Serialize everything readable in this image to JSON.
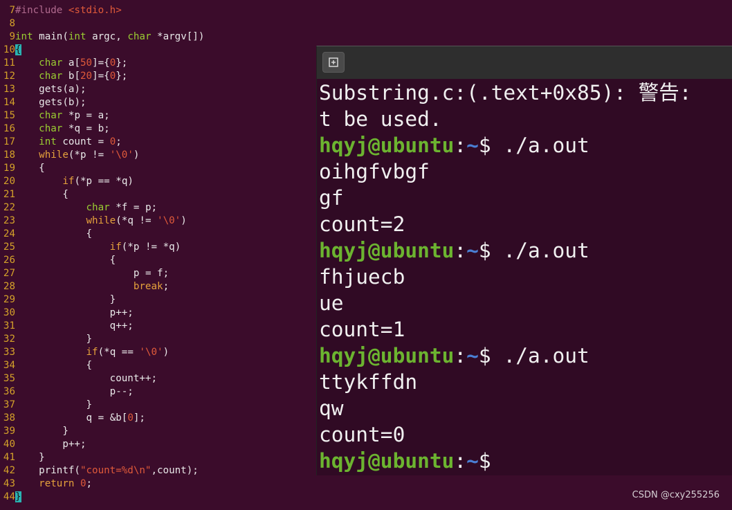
{
  "editor": {
    "lines": [
      {
        "n": "7",
        "t": "#include <stdio.h>"
      },
      {
        "n": "8",
        "t": ""
      },
      {
        "n": "9",
        "t": "int main(int argc, char *argv[])"
      },
      {
        "n": "10",
        "t": "{"
      },
      {
        "n": "11",
        "t": "    char a[50]={0};"
      },
      {
        "n": "12",
        "t": "    char b[20]={0};"
      },
      {
        "n": "13",
        "t": "    gets(a);"
      },
      {
        "n": "14",
        "t": "    gets(b);"
      },
      {
        "n": "15",
        "t": "    char *p = a;"
      },
      {
        "n": "16",
        "t": "    char *q = b;"
      },
      {
        "n": "17",
        "t": "    int count = 0;"
      },
      {
        "n": "18",
        "t": "    while(*p != '\\0')"
      },
      {
        "n": "19",
        "t": "    {"
      },
      {
        "n": "20",
        "t": "        if(*p == *q)"
      },
      {
        "n": "21",
        "t": "        {"
      },
      {
        "n": "22",
        "t": "            char *f = p;"
      },
      {
        "n": "23",
        "t": "            while(*q != '\\0')"
      },
      {
        "n": "24",
        "t": "            {"
      },
      {
        "n": "25",
        "t": "                if(*p != *q)"
      },
      {
        "n": "26",
        "t": "                {"
      },
      {
        "n": "27",
        "t": "                    p = f;"
      },
      {
        "n": "28",
        "t": "                    break;"
      },
      {
        "n": "29",
        "t": "                }"
      },
      {
        "n": "30",
        "t": "                p++;"
      },
      {
        "n": "31",
        "t": "                q++;"
      },
      {
        "n": "32",
        "t": "            }"
      },
      {
        "n": "33",
        "t": "            if(*q == '\\0')"
      },
      {
        "n": "34",
        "t": "            {"
      },
      {
        "n": "35",
        "t": "                count++;"
      },
      {
        "n": "36",
        "t": "                p--;"
      },
      {
        "n": "37",
        "t": "            }"
      },
      {
        "n": "38",
        "t": "            q = &b[0];"
      },
      {
        "n": "39",
        "t": "        }"
      },
      {
        "n": "40",
        "t": "        p++;"
      },
      {
        "n": "41",
        "t": "    }"
      },
      {
        "n": "42",
        "t": "    printf(\"count=%d\\n\",count);"
      },
      {
        "n": "43",
        "t": "    return 0;"
      },
      {
        "n": "44",
        "t": "}"
      }
    ]
  },
  "terminal": {
    "user_host": "hqyj@ubuntu",
    "colon": ":",
    "path": "~",
    "prompt_symbol": "$",
    "lines": [
      {
        "kind": "out",
        "text": "Substring.c:(.text+0x85): 警告: "
      },
      {
        "kind": "out",
        "text": "t be used."
      },
      {
        "kind": "prompt",
        "cmd": " ./a.out"
      },
      {
        "kind": "out",
        "text": "oihgfvbgf"
      },
      {
        "kind": "out",
        "text": "gf"
      },
      {
        "kind": "out",
        "text": "count=2"
      },
      {
        "kind": "prompt",
        "cmd": " ./a.out"
      },
      {
        "kind": "out",
        "text": "fhjuecb"
      },
      {
        "kind": "out",
        "text": "ue"
      },
      {
        "kind": "out",
        "text": "count=1"
      },
      {
        "kind": "prompt",
        "cmd": " ./a.out"
      },
      {
        "kind": "out",
        "text": "ttykffdn"
      },
      {
        "kind": "out",
        "text": "qw"
      },
      {
        "kind": "out",
        "text": "count=0"
      },
      {
        "kind": "prompt",
        "cmd": ""
      }
    ]
  },
  "icons": {
    "new_tab": "new-tab-icon"
  },
  "colors": {
    "editor_bg": "#3b0c2b",
    "terminal_bg": "#300a24",
    "user_host": "#6cb430",
    "path": "#4a7fd4",
    "keyword": "#9acd32",
    "control": "#e6a23c",
    "literal": "#e05a3a",
    "line_number": "#d4a12a",
    "cursor": "#2ab3b3"
  },
  "watermark": "CSDN @cxy255256"
}
